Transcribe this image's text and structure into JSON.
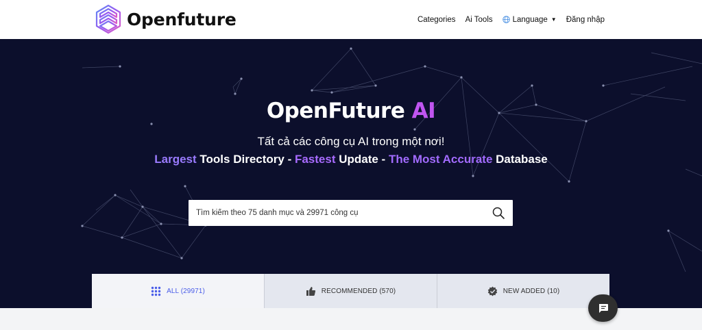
{
  "header": {
    "logo_text": "Openfuture",
    "nav": {
      "categories": "Categories",
      "ai_tools": "Ai Tools",
      "language": "Language",
      "login": "Đăng nhập"
    }
  },
  "hero": {
    "title_main": "OpenFuture ",
    "title_ai": "AI",
    "subtitle": "Tất cả các công cụ AI trong một nơi!",
    "tagline": {
      "w1": "Largest",
      "w2": " Tools Directory - ",
      "w3": "Fastest",
      "w4": " Update - ",
      "w5": "The Most Accurate",
      "w6": " Database"
    },
    "search_placeholder": "Tìm kiếm theo 75 danh mục và 29971 công cụ"
  },
  "tabs": [
    {
      "label": "ALL (29971)",
      "icon": "grid-icon",
      "active": true
    },
    {
      "label": "RECOMMENDED (570)",
      "icon": "thumbs-up-icon",
      "active": false
    },
    {
      "label": "NEW ADDED (10)",
      "icon": "new-badge-icon",
      "active": false
    }
  ],
  "colors": {
    "hero_bg": "#0c0f2c",
    "accent_purple": "#c055f0",
    "tag_purple": "#9a7bff",
    "active_tab_text": "#4a5de8"
  }
}
